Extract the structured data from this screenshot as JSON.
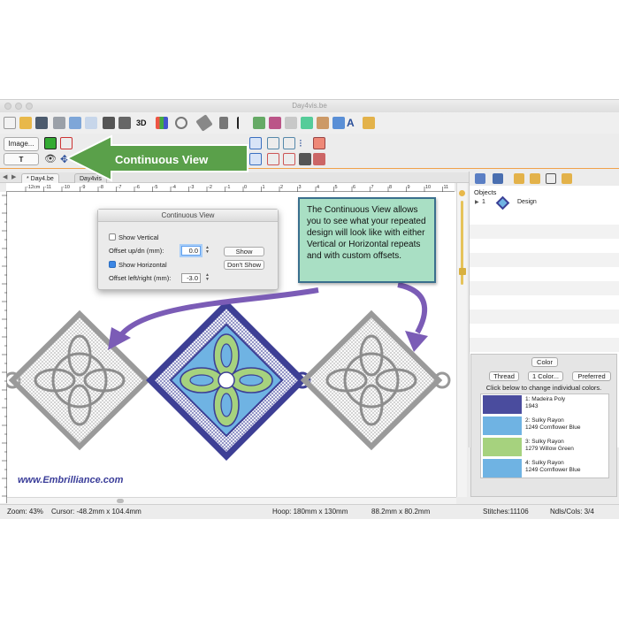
{
  "window": {
    "title": "Day4vis.be"
  },
  "toolbar": {
    "image_button": "Image...",
    "text_button": "T"
  },
  "tabs": [
    "* Day4.be",
    "Day4vis"
  ],
  "ruler": {
    "labels": [
      "-12cm",
      "-11",
      "-10",
      "-9",
      "-8",
      "-7",
      "-6",
      "-5",
      "-4",
      "-3",
      "-2",
      "-1",
      "0",
      "1",
      "2",
      "3",
      "4",
      "5",
      "6",
      "7",
      "8",
      "9",
      "10",
      "11",
      "12"
    ]
  },
  "callout_arrow": {
    "label": "Continuous View",
    "color": "#5aa04a"
  },
  "dialog": {
    "title": "Continuous View",
    "show_vertical": "Show Vertical",
    "offset_updn_label": "Offset up/dn (mm):",
    "offset_updn_value": "0.0",
    "show_horizontal": "Show Horizontal",
    "offset_lr_label": "Offset left/right (mm):",
    "offset_lr_value": "-3.0",
    "show_button": "Show",
    "dont_show_button": "Don't Show"
  },
  "callout": {
    "text": "The Continuous View allows you to see what your repeated design will look like with either Vertical or Horizontal repeats and with custom offsets.",
    "background": "#a9dfc4",
    "border": "#3a6f8d"
  },
  "watermark": "www.Embrilliance.com",
  "objects_panel": {
    "label": "Objects",
    "items": [
      {
        "index": "1",
        "name": "Design"
      }
    ]
  },
  "color_panel": {
    "header_button": "Color",
    "thread_button": "Thread",
    "one_color_button": "1 Color...",
    "preferred_button": "Preferred",
    "hint": "Click below to change individual colors.",
    "threads": [
      {
        "line1": "1: Madeira Poly",
        "line2": "1943",
        "color": "#4a4c9e"
      },
      {
        "line1": "2: Sulky Rayon",
        "line2": "1249 Cornflower Blue",
        "color": "#6fb3e3"
      },
      {
        "line1": "3: Sulky Rayon",
        "line2": "1279 Willow Green",
        "color": "#a6d27e"
      },
      {
        "line1": "4: Sulky Rayon",
        "line2": "1249 Cornflower Blue",
        "color": "#6fb3e3"
      }
    ]
  },
  "status": {
    "zoom": "Zoom: 43%",
    "cursor": "Cursor: -48.2mm x 104.4mm",
    "hoop": "Hoop: 180mm x 130mm",
    "size": "88.2mm x 80.2mm",
    "stitches": "Stitches:11106",
    "ndls": "Ndls/Cols: 3/4"
  },
  "colors": {
    "accent_border": "#f0a24a",
    "arrow_purple": "#7b5cb6",
    "design_navy": "#3d3f95"
  }
}
